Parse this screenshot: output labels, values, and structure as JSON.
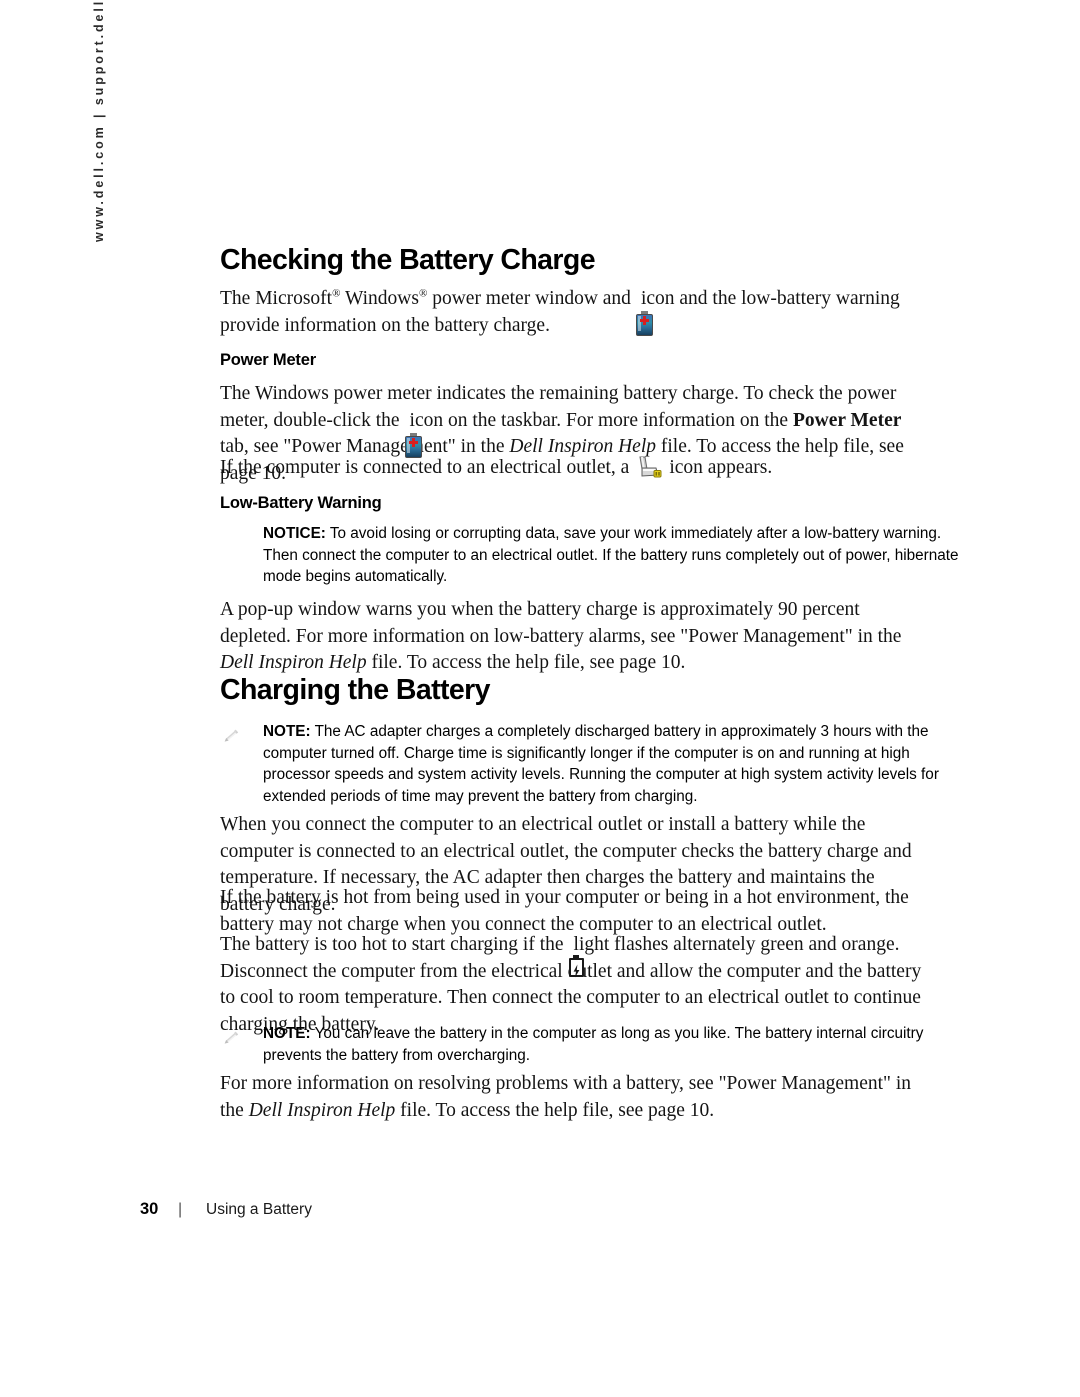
{
  "sidebar": {
    "url_text": "www.dell.com | support.dell.com"
  },
  "sections": {
    "heading_1": "Checking the Battery Charge",
    "intro_p1_a": "The Microsoft",
    "intro_p1_b": "Windows",
    "intro_p1_c": "power meter window and",
    "intro_p1_d": "icon and the low-battery warning provide information on the battery charge.",
    "subheading_power_meter": "Power Meter",
    "pm_p1_a": "The Windows power meter indicates the remaining battery charge. To check the power meter, double-click the",
    "pm_p1_b": "icon on the taskbar. For more information on the",
    "pm_p1_bold": "Power Meter",
    "pm_p1_c": "tab, see \"Power Management\" in the",
    "pm_p1_italic": "Dell Inspiron Help",
    "pm_p1_d": "file. To access the help file, see page 10.",
    "pm_p2_a": "If the computer is connected to an electrical outlet, a",
    "pm_p2_b": "icon appears.",
    "subheading_low_battery": "Low-Battery Warning",
    "notice_label": "NOTICE:",
    "notice_text": "To avoid losing or corrupting data, save your work immediately after a low-battery warning. Then connect the computer to an electrical outlet. If the battery runs completely out of power, hibernate mode begins automatically.",
    "lb_p1_a": "A pop-up window warns you when the battery charge is approximately 90 percent depleted. For more information on low-battery alarms, see \"Power Management\" in the",
    "lb_p1_italic": "Dell Inspiron Help",
    "lb_p1_b": "file. To access the help file, see page 10.",
    "heading_2": "Charging the Battery",
    "note1_label": "NOTE:",
    "note1_text": "The AC adapter charges a completely discharged battery in approximately 3 hours with the computer turned off. Charge time is significantly longer if the computer is on and running at high processor speeds and system activity levels. Running the computer at high system activity levels for extended periods of time may prevent the battery from charging.",
    "cb_p1": "When you connect the computer to an electrical outlet or install a battery while the computer is connected to an electrical outlet, the computer checks the battery charge and temperature. If necessary, the AC adapter then charges the battery and maintains the battery charge.",
    "cb_p2": "If the battery is hot from being used in your computer or being in a hot environment, the battery may not charge when you connect the computer to an electrical outlet.",
    "cb_p3_a": "The battery is too hot to start charging if the",
    "cb_p3_b": "light flashes alternately green and orange. Disconnect the computer from the electrical outlet and allow the computer and the battery to cool to room temperature. Then connect the computer to an electrical outlet to continue charging the battery.",
    "note2_label": "NOTE:",
    "note2_text": "You can leave the battery in the computer as long as you like. The battery internal circuitry prevents the battery from overcharging.",
    "cb_p4_a": "For more information on resolving problems with a battery, see \"Power Management\" in the",
    "cb_p4_italic": "Dell Inspiron Help",
    "cb_p4_b": "file. To access the help file, see page 10."
  },
  "icons": {
    "taskbar_battery": "battery-icon",
    "ac_plug": "power-plug-icon",
    "status_battery": "battery-bolt-icon",
    "notice": "notice-arrow-icon",
    "note": "note-pencil-icon"
  },
  "footer": {
    "page_number": "30",
    "separator": "|",
    "chapter": "Using a Battery"
  },
  "colors": {
    "text": "#141414",
    "battery_blue": "#2f8ea8",
    "battery_plus_red": "#d81f1f",
    "plug_yellow": "#e8d21a",
    "icon_black": "#111111"
  }
}
